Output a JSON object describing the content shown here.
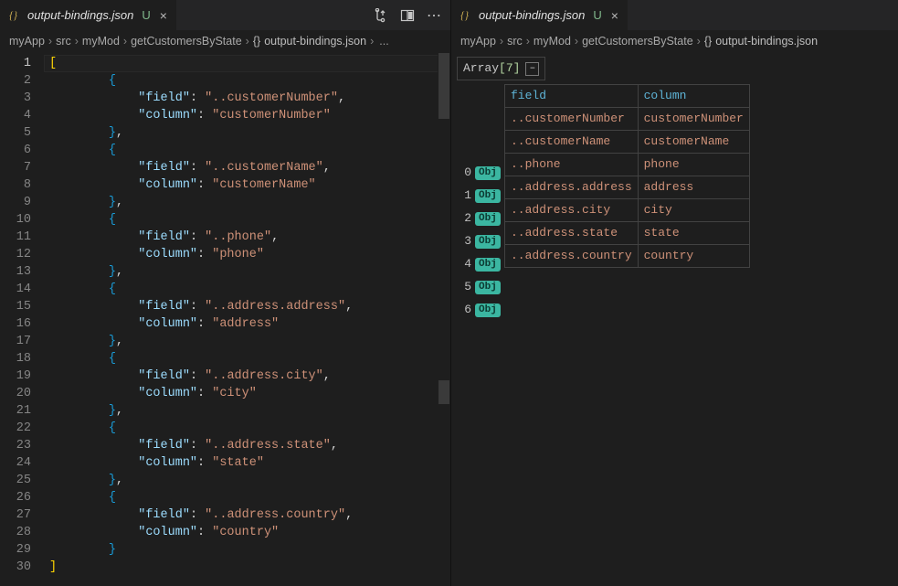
{
  "left": {
    "tab": {
      "filename": "output-bindings.json",
      "modified_marker": "U"
    },
    "breadcrumb": [
      "myApp",
      "src",
      "myMod",
      "getCustomersByState",
      "output-bindings.json"
    ],
    "breadcrumb_trailing": "...",
    "toolbar": {
      "more": "⋯"
    },
    "code": {
      "key_field": "field",
      "key_column": "column",
      "entries": [
        {
          "field": "..customerNumber",
          "column": "customerNumber"
        },
        {
          "field": "..customerName",
          "column": "customerName"
        },
        {
          "field": "..phone",
          "column": "phone"
        },
        {
          "field": "..address.address",
          "column": "address"
        },
        {
          "field": "..address.city",
          "column": "city"
        },
        {
          "field": "..address.state",
          "column": "state"
        },
        {
          "field": "..address.country",
          "column": "country"
        }
      ],
      "line_count": 30
    }
  },
  "right": {
    "tab": {
      "filename": "output-bindings.json",
      "modified_marker": "U"
    },
    "breadcrumb": [
      "myApp",
      "src",
      "myMod",
      "getCustomersByState",
      "output-bindings.json"
    ],
    "array_label": "Array",
    "array_len": "[7]",
    "collapse_label": "–",
    "obj_badge": "Obj",
    "table": {
      "headers": [
        "field",
        "column"
      ],
      "rows": [
        [
          "..customerNumber",
          "customerNumber"
        ],
        [
          "..customerName",
          "customerName"
        ],
        [
          "..phone",
          "phone"
        ],
        [
          "..address.address",
          "address"
        ],
        [
          "..address.city",
          "city"
        ],
        [
          "..address.state",
          "state"
        ],
        [
          "..address.country",
          "country"
        ]
      ]
    }
  },
  "chart_data": {
    "type": "table",
    "title": "output-bindings.json array preview",
    "headers": [
      "index",
      "field",
      "column"
    ],
    "rows": [
      [
        0,
        "..customerNumber",
        "customerNumber"
      ],
      [
        1,
        "..customerName",
        "customerName"
      ],
      [
        2,
        "..phone",
        "phone"
      ],
      [
        3,
        "..address.address",
        "address"
      ],
      [
        4,
        "..address.city",
        "city"
      ],
      [
        5,
        "..address.state",
        "state"
      ],
      [
        6,
        "..address.country",
        "country"
      ]
    ]
  }
}
